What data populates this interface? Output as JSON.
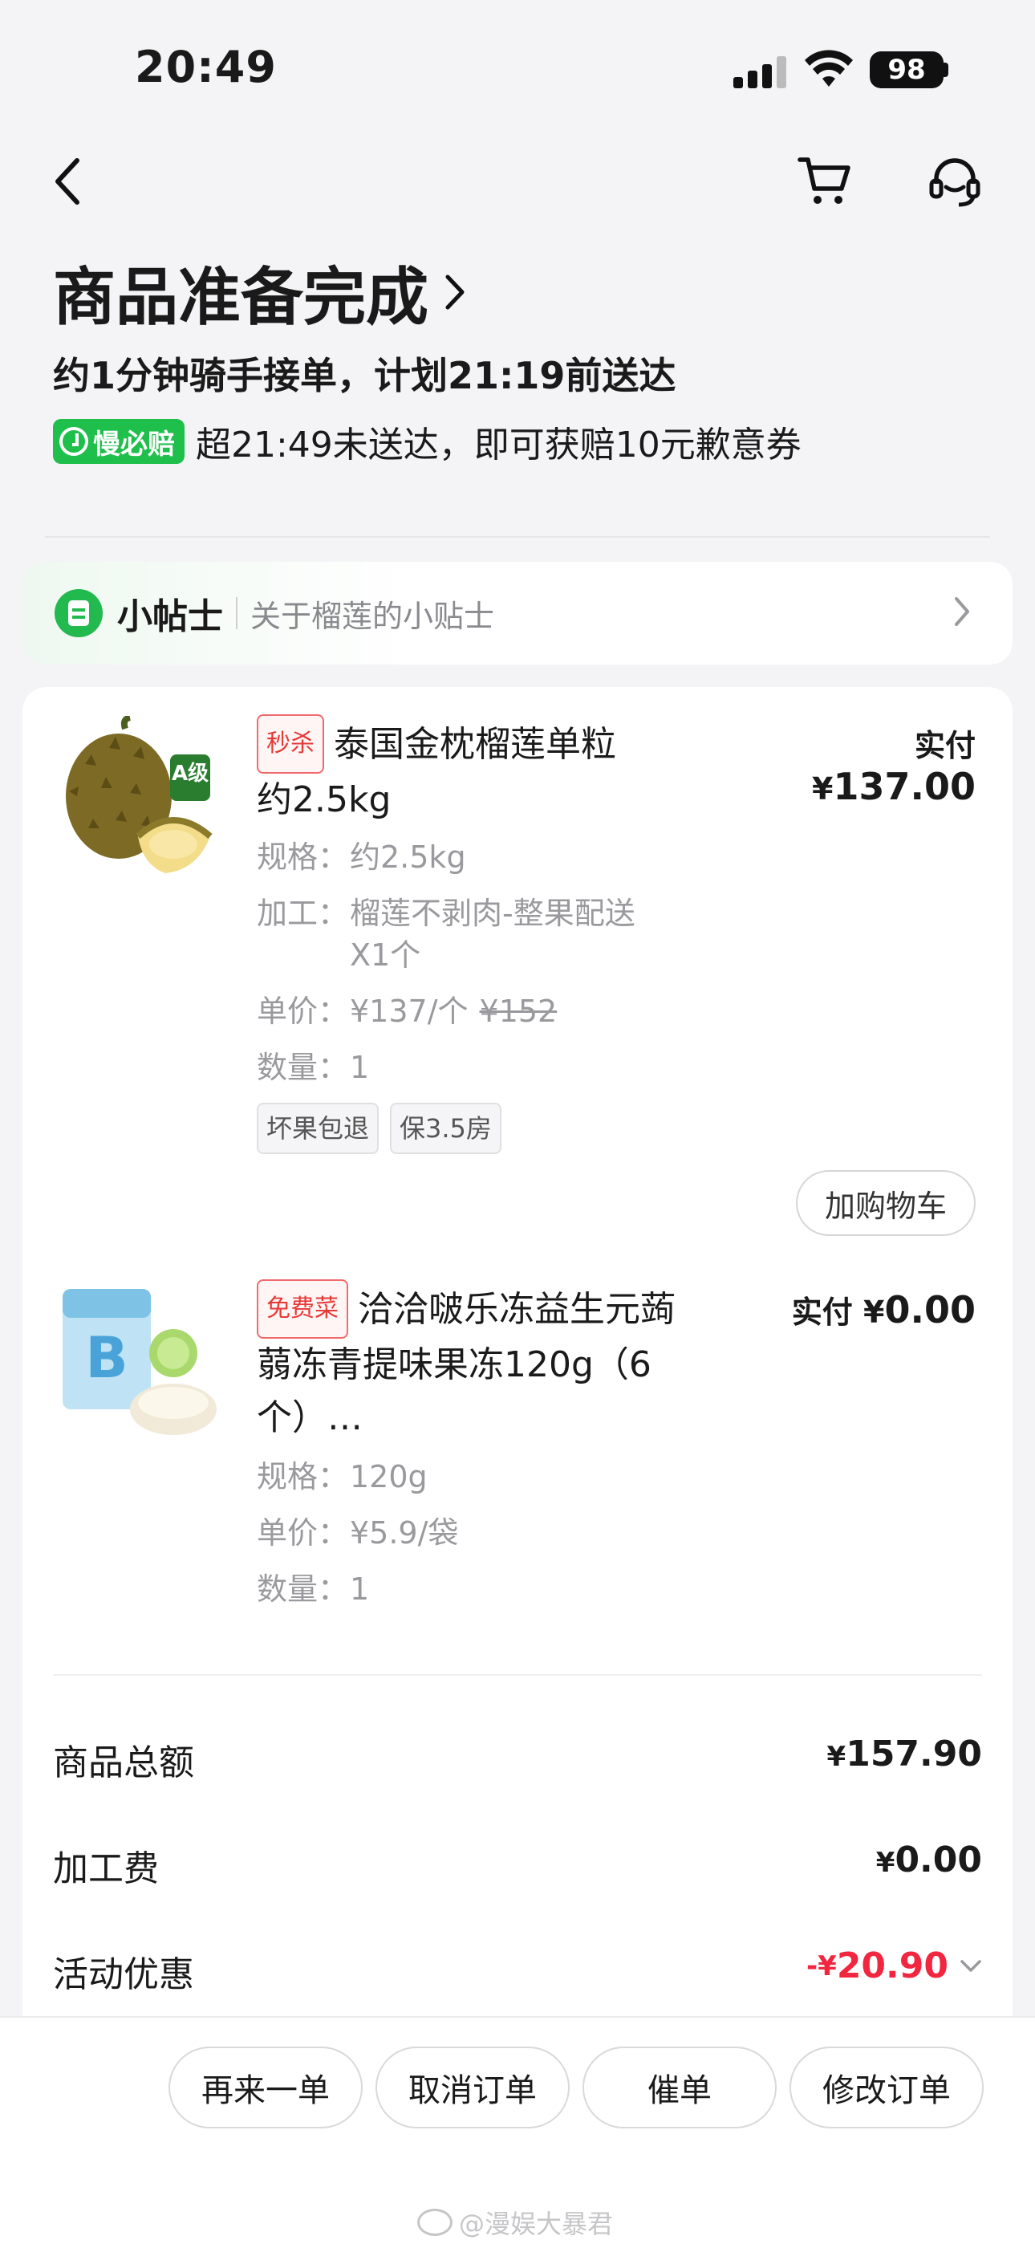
{
  "status_bar": {
    "time": "20:49",
    "battery": "98"
  },
  "icons": {
    "back": "back-chevron-icon",
    "cart": "shopping-cart-icon",
    "service": "customer-service-headset-icon",
    "wifi": "wifi-icon",
    "signal": "cellular-signal-icon"
  },
  "order": {
    "status_title": "商品准备完成",
    "eta": "约1分钟骑手接单，计划21:19前送达",
    "guarantee_badge": "慢必赔",
    "guarantee_text": "超21:49未送达，即可获赔10元歉意券"
  },
  "tips": {
    "title": "小帖士",
    "subtitle": "关于榴莲的小贴士"
  },
  "products": [
    {
      "tag": "秒杀",
      "name_line1": "泰国金枕榴莲单粒",
      "name_line2": "约2.5kg",
      "price_label": "实付",
      "price_currency": "¥",
      "price": "137.00",
      "spec_label": "规格：",
      "spec": "约2.5kg",
      "process_label": "加工：",
      "process_line1": "榴莲不剥肉-整果配送",
      "process_line2": "X1个",
      "unit_label": "单价：",
      "unit_price": "¥137/个",
      "original_price": "¥152",
      "qty_label": "数量：",
      "qty": "1",
      "service_tags": [
        "坏果包退",
        "保3.5房"
      ],
      "add_cart": "加购物车",
      "badge_text": "A级"
    },
    {
      "tag": "免费菜",
      "name_line1": "洽洽啵乐冻益生元蒟",
      "name_line2": "蒻冻青提味果冻120g（6",
      "name_line3": "个）…",
      "price_label": "实付",
      "price_currency": "¥",
      "price": "0.00",
      "spec_label": "规格：",
      "spec": "120g",
      "unit_label": "单价：",
      "unit_price": "¥5.9/袋",
      "qty_label": "数量：",
      "qty": "1"
    }
  ],
  "summary": [
    {
      "label": "商品总额",
      "currency": "¥",
      "value": "157.90"
    },
    {
      "label": "加工费",
      "currency": "¥",
      "value": "0.00"
    },
    {
      "label": "活动优惠",
      "currency": "-¥",
      "value": "20.90"
    }
  ],
  "actions": [
    "再来一单",
    "取消订单",
    "催单",
    "修改订单"
  ],
  "watermark": "@漫娱大暴君",
  "colors": {
    "accent_green": "#1fbf4b",
    "discount_red": "#f2263f",
    "tag_red": "#e53935"
  }
}
